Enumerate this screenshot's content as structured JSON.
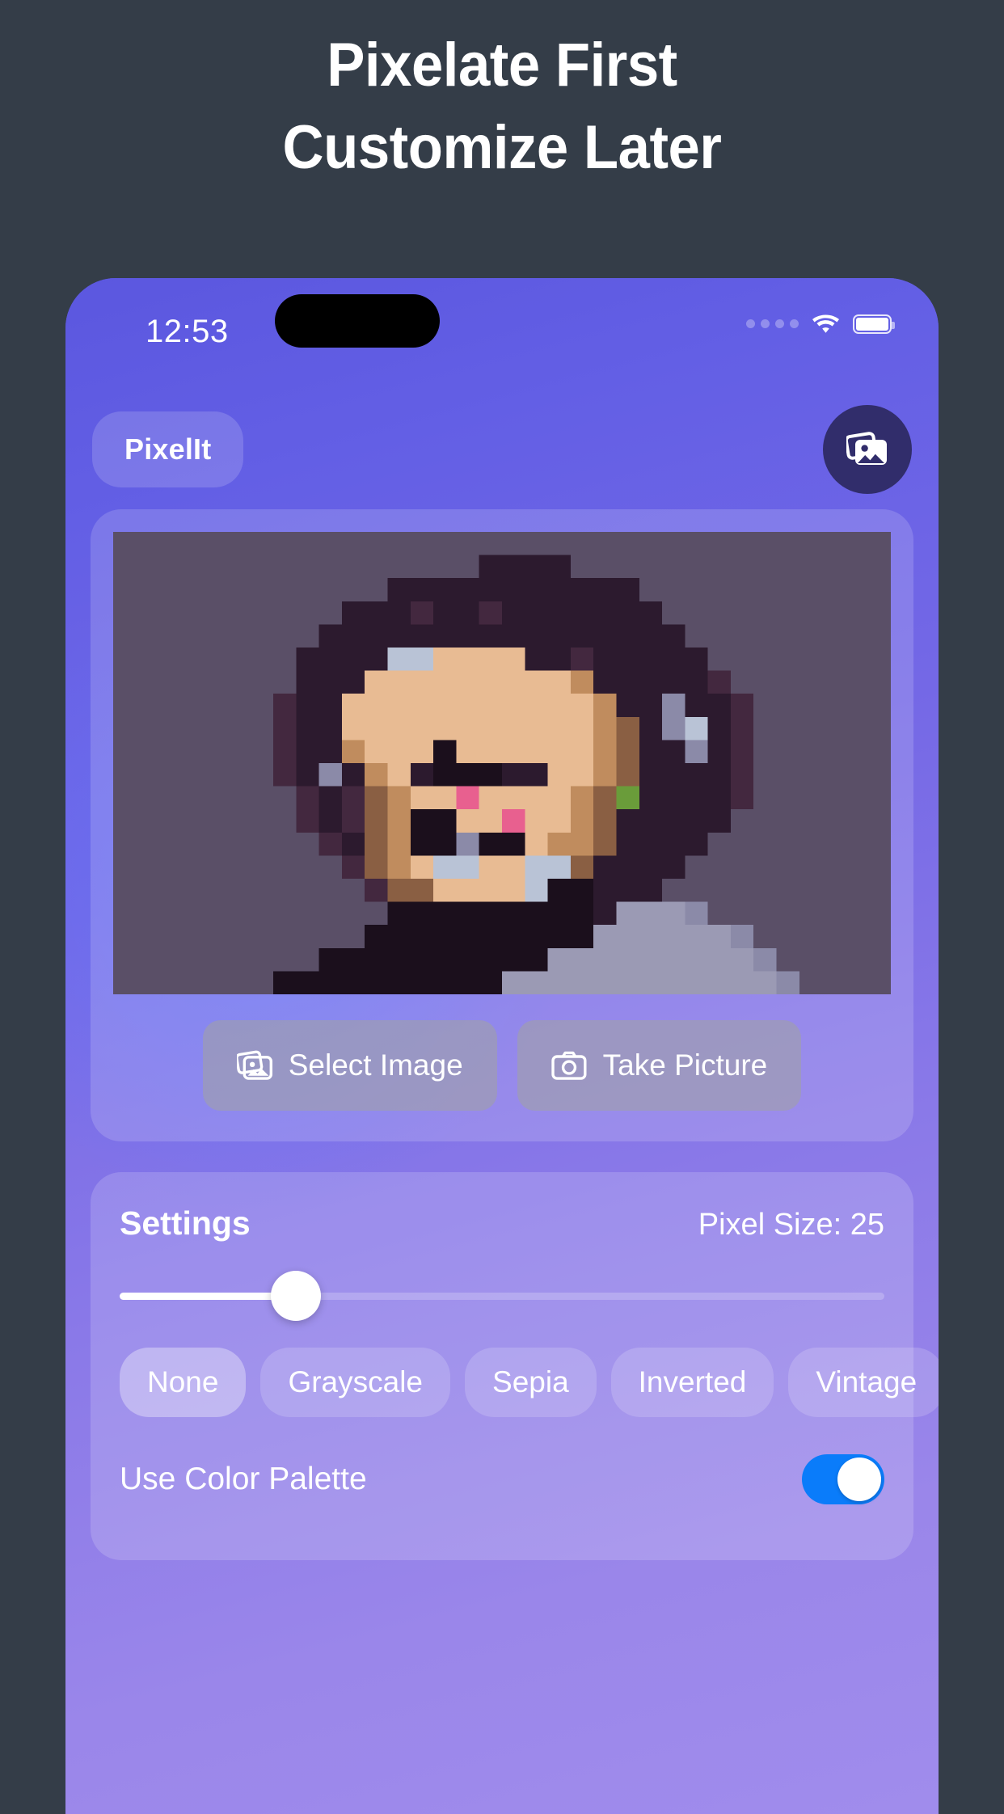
{
  "promo": {
    "line1": "Pixelate First",
    "line2": "Customize Later",
    "background_color": "#343d48",
    "text_color": "#ffffff"
  },
  "status_bar": {
    "time": "12:53",
    "signal_icon": "signal-dots-icon",
    "wifi_icon": "wifi-icon",
    "battery_icon": "battery-full-icon",
    "battery_level": "100"
  },
  "app_header": {
    "title": "PixelIt",
    "gallery_button_icon": "gallery-icon"
  },
  "preview": {
    "image_alt": "pixelated portrait",
    "select_image_label": "Select Image",
    "select_image_icon": "gallery-icon",
    "take_picture_label": "Take Picture",
    "take_picture_icon": "camera-icon"
  },
  "settings": {
    "title": "Settings",
    "pixel_size_label": "Pixel Size: 25",
    "pixel_size_value": 25,
    "slider_percent": 23,
    "filters": [
      {
        "label": "None",
        "selected": true
      },
      {
        "label": "Grayscale",
        "selected": false
      },
      {
        "label": "Sepia",
        "selected": false
      },
      {
        "label": "Inverted",
        "selected": false
      },
      {
        "label": "Vintage",
        "selected": false
      }
    ],
    "color_palette_label": "Use Color Palette",
    "color_palette_on": true
  },
  "colors": {
    "phone_purple_top": "#5b57df",
    "phone_purple_bottom": "#a08cec",
    "toggle_on": "#0a7cfa",
    "gallery_btn": "#312d6b",
    "image_bg": "#5a4f67"
  },
  "pixel_art": {
    "cols": 34,
    "rows": 20,
    "palette": {
      "B": "#5a4f67",
      "H": "#2c1a2e",
      "h": "#43283f",
      "S": "#e8bb93",
      "s": "#c08c5e",
      "d": "#8a5f43",
      "g": "#8b8aa8",
      "G": "#9b9ab4",
      "w": "#b9c3d6",
      "p": "#e8608f",
      "n": "#6a9c3a",
      "k": "#1b0f1c"
    },
    "rows_data": [
      "BBBBBBBBBBBBBBBBBBBBBBBBBBBBBBBBBB",
      "BBBBBBBBBBBBBBBBHHHHBBBBBBBBBBBBBB",
      "BBBBBBBBBBBBHHHHHHHHHHHBBBBBBBBBBB",
      "BBBBBBBBBBHHHhHHhHHHHHHHBBBBBBBBBB",
      "BBBBBBBBBHHHHHHHHHHHHHHHHBBBBBBBBB",
      "BBBBBBBBHHHHwwSSSSHHhHHHHHBBBBBBBB",
      "BBBBBBBBHHHSSSSSSSSSsHHHHHhBBBBBBB",
      "BBBBBBBhHHSSSSSSSSSSSsHHgHHhBBBBBB",
      "BBBBBBBhHHSSSSSSSSSSSsdHgwHhBBBBBB",
      "BBBBBBBhHHsSSSkSSSSSSsdHHgHhBBBBBB",
      "BBBBBBBhHgHsSHkkkHHSSsdHHHHhBBBBBB",
      "BBBBBBBBhHhdsSSpSSSSsdnHHHHhBBBBBB",
      "BBBBBBBBhHhdskkSSpSSsdHHHHHbBBBBBB",
      "BBBBBBBBBhHdskkgkkSssdHHHHBBBBBBBB",
      "BBBBBBBBBBhdsSwwSSwwdHHHHBBBBBBBBB",
      "BBBBBBBBBBBhddSSSSwkkHHHBBBBBBBBBB",
      "BBBBBBBBBBBBkkkkkkkkkHGGGgBBBBBBBB",
      "BBBBBBBBBBBkkkkkkkkkkGGGGGGgBBBBBB",
      "BBBBBBBBBkkkkkkkkkkGGGGGGGGGgBBBBB",
      "BBBBBBBkkkkkkkkkkGGGGGGGGGGGGgBBBB"
    ]
  }
}
